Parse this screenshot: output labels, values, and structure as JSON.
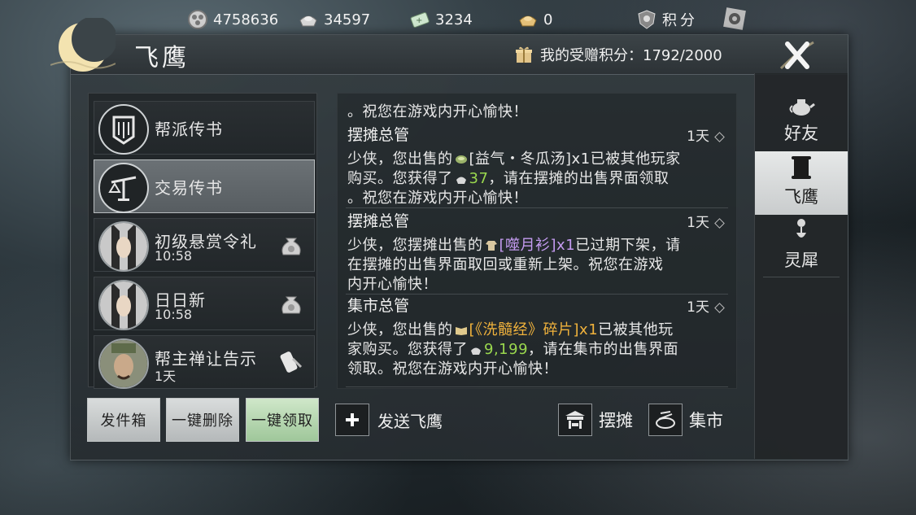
{
  "topbar": {
    "coins": "4758636",
    "silver": "34597",
    "tickets": "3234",
    "ingots": "0",
    "points_label": "积分"
  },
  "panel": {
    "title": "飞鹰",
    "gift_points": "我的受赠积分：1792/2000"
  },
  "mail_list": [
    {
      "name": "帮派传书",
      "time": ""
    },
    {
      "name": "交易传书",
      "time": ""
    },
    {
      "name": "初级悬赏令礼",
      "time": "10:58"
    },
    {
      "name": "日日新",
      "time": "10:58"
    },
    {
      "name": "帮主禅让告示",
      "time": "1天"
    }
  ],
  "buttons": {
    "outbox": "发件箱",
    "delete_all": "一键删除",
    "claim_all": "一键领取"
  },
  "messages": {
    "top_tail": "。祝您在游戏内开心愉快！",
    "m1": {
      "sender": "摆摊总管",
      "age": "1天",
      "l1_a": "少侠，您出售的",
      "l1_item": "[益气・冬瓜汤]x1",
      "l1_b": "已被其他玩家",
      "l2_a": "购买。您获得了",
      "l2_amount": "37",
      "l2_b": "，请在摆摊的出售界面领取",
      "l3": "。祝您在游戏内开心愉快！"
    },
    "m2": {
      "sender": "摆摊总管",
      "age": "1天",
      "l1_a": "少侠，您摆摊出售的",
      "l1_item": "[噬月衫]x1",
      "l1_b": "已过期下架，请",
      "l2": "在摆摊的出售界面取回或重新上架。祝您在游戏",
      "l3": "内开心愉快！"
    },
    "m3": {
      "sender": "集市总管",
      "age": "1天",
      "l1_a": "少侠，您出售的",
      "l1_item": "[《洗髓经》碎片]x1",
      "l1_b": "已被其他玩",
      "l2_a": "家购买。您获得了",
      "l2_amount": "9,199",
      "l2_b": "，请在集市的出售界面",
      "l3": "领取。祝您在游戏内开心愉快！"
    }
  },
  "actions": {
    "send": "发送飞鹰",
    "stall": "摆摊",
    "market": "集市"
  },
  "tabs": [
    "好友",
    "飞鹰",
    "灵犀"
  ]
}
